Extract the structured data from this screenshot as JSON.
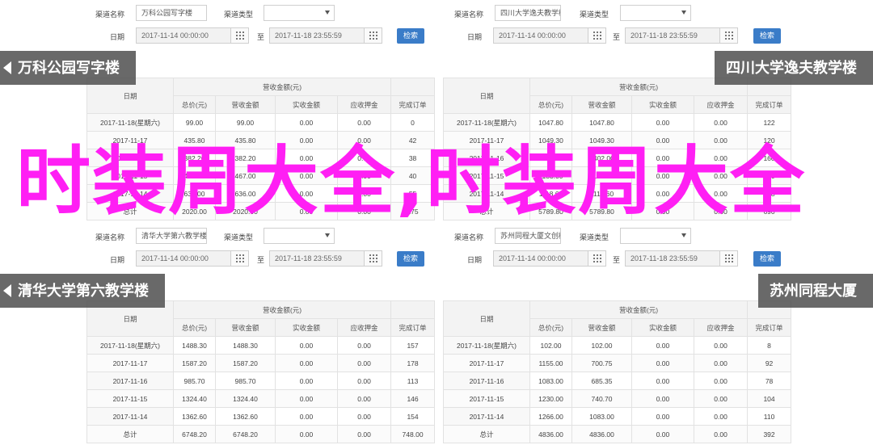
{
  "form_labels": {
    "channel": "渠道名称",
    "channel_type": "渠道类型",
    "date": "日期",
    "to": "至",
    "search": "检索"
  },
  "table_headers": {
    "date": "日期",
    "group": "营收金额(元)",
    "total": "总价(元)",
    "revenue": "营收金额",
    "actual": "实收金额",
    "deposit": "应收押金",
    "orders": "完成订单"
  },
  "panels": [
    {
      "channel_value": "万科公园写字楼",
      "date_from": "2017-11-14 00:00:00",
      "date_to": "2017-11-18 23:55:59",
      "banner": "万科公园写字楼",
      "rows": [
        [
          "2017-11-18(星期六)",
          "99.00",
          "99.00",
          "0.00",
          "0.00",
          "0"
        ],
        [
          "2017-11-17",
          "435.80",
          "435.80",
          "0.00",
          "0.00",
          "42"
        ],
        [
          "2017-11-16",
          "382.20",
          "382.20",
          "0.00",
          "0.00",
          "38"
        ],
        [
          "2017-11-15",
          "467.00",
          "467.00",
          "0.00",
          "0.00",
          "40"
        ],
        [
          "2017-11-14",
          "636.00",
          "636.00",
          "0.00",
          "0.00",
          "55"
        ],
        [
          "总计",
          "2020.00",
          "2020.00",
          "0.00",
          "0.00",
          "175"
        ]
      ]
    },
    {
      "channel_value": "四川大学逸夫教学楼",
      "date_from": "2017-11-14 00:00:00",
      "date_to": "2017-11-18 23:55:59",
      "banner": "四川大学逸夫教学楼",
      "rows": [
        [
          "2017-11-18(星期六)",
          "1047.80",
          "1047.80",
          "0.00",
          "0.00",
          "122"
        ],
        [
          "2017-11-17",
          "1049.30",
          "1049.30",
          "0.00",
          "0.00",
          "120"
        ],
        [
          "2017-11-16",
          "1402.00",
          "1402.00",
          "0.00",
          "0.00",
          "160"
        ],
        [
          "2017-11-15",
          "1183.00",
          "1183.00",
          "0.00",
          "0.00",
          "160"
        ],
        [
          "2017-11-14",
          "1118.60",
          "1118.60",
          "0.00",
          "0.00",
          "128"
        ],
        [
          "总计",
          "5789.80",
          "5789.80",
          "0.00",
          "0.00",
          "690"
        ]
      ]
    },
    {
      "channel_value": "清华大学第六教学楼",
      "date_from": "2017-11-14 00:00:00",
      "date_to": "2017-11-18 23:55:59",
      "banner": "清华大学第六教学楼",
      "rows": [
        [
          "2017-11-18(星期六)",
          "1488.30",
          "1488.30",
          "0.00",
          "0.00",
          "157"
        ],
        [
          "2017-11-17",
          "1587.20",
          "1587.20",
          "0.00",
          "0.00",
          "178"
        ],
        [
          "2017-11-16",
          "985.70",
          "985.70",
          "0.00",
          "0.00",
          "113"
        ],
        [
          "2017-11-15",
          "1324.40",
          "1324.40",
          "0.00",
          "0.00",
          "146"
        ],
        [
          "2017-11-14",
          "1362.60",
          "1362.60",
          "0.00",
          "0.00",
          "154"
        ],
        [
          "总计",
          "6748.20",
          "6748.20",
          "0.00",
          "0.00",
          "748.00"
        ]
      ]
    },
    {
      "channel_value": "苏州同程大厦文创楼",
      "date_from": "2017-11-14 00:00:00",
      "date_to": "2017-11-18 23:55:59",
      "banner": "苏州同程大厦",
      "rows": [
        [
          "2017-11-18(星期六)",
          "102.00",
          "102.00",
          "0.00",
          "0.00",
          "8"
        ],
        [
          "2017-11-17",
          "1155.00",
          "700.75",
          "0.00",
          "0.00",
          "92"
        ],
        [
          "2017-11-16",
          "1083.00",
          "685.35",
          "0.00",
          "0.00",
          "78"
        ],
        [
          "2017-11-15",
          "1230.00",
          "740.70",
          "0.00",
          "0.00",
          "104"
        ],
        [
          "2017-11-14",
          "1266.00",
          "1083.00",
          "0.00",
          "0.00",
          "110"
        ],
        [
          "总计",
          "4836.00",
          "4836.00",
          "0.00",
          "0.00",
          "392"
        ]
      ]
    }
  ],
  "overlay_title": "时装周大全,时装周大全",
  "colors": {
    "overlay": "#ff1ff4",
    "button": "#3a7cc8",
    "banner": "#505050"
  },
  "icons": {
    "calendar": "calendar-icon",
    "dropdown": "chevron-down-icon",
    "banner_arrow": "arrow-left-icon"
  }
}
